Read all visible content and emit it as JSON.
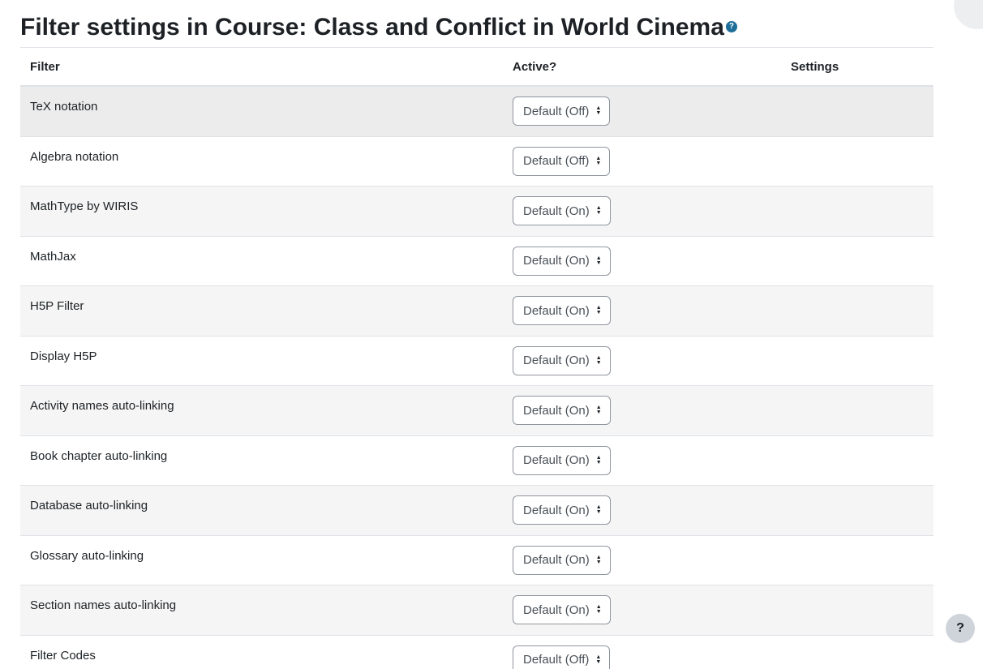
{
  "page": {
    "title": "Filter settings in Course: Class and Conflict in World Cinema",
    "help_icon_glyph": "?"
  },
  "table": {
    "headers": {
      "filter": "Filter",
      "active": "Active?",
      "settings": "Settings"
    },
    "rows": [
      {
        "filter": "TeX notation",
        "active": "Default (Off)",
        "settings": ""
      },
      {
        "filter": "Algebra notation",
        "active": "Default (Off)",
        "settings": ""
      },
      {
        "filter": "MathType by WIRIS",
        "active": "Default (On)",
        "settings": ""
      },
      {
        "filter": "MathJax",
        "active": "Default (On)",
        "settings": ""
      },
      {
        "filter": "H5P Filter",
        "active": "Default (On)",
        "settings": ""
      },
      {
        "filter": "Display H5P",
        "active": "Default (On)",
        "settings": ""
      },
      {
        "filter": "Activity names auto-linking",
        "active": "Default (On)",
        "settings": ""
      },
      {
        "filter": "Book chapter auto-linking",
        "active": "Default (On)",
        "settings": ""
      },
      {
        "filter": "Database auto-linking",
        "active": "Default (On)",
        "settings": ""
      },
      {
        "filter": "Glossary auto-linking",
        "active": "Default (On)",
        "settings": ""
      },
      {
        "filter": "Section names auto-linking",
        "active": "Default (On)",
        "settings": ""
      },
      {
        "filter": "Filter Codes",
        "active": "Default (Off)",
        "settings": ""
      }
    ]
  },
  "floating_help": {
    "glyph": "?"
  },
  "colors": {
    "accent": "#1f6e9a",
    "stripe": "#f5f5f5",
    "hover": "#ececec",
    "border": "#dee2e6"
  }
}
